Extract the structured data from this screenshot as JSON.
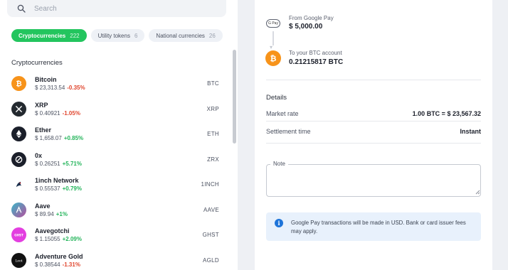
{
  "search": {
    "placeholder": "Search"
  },
  "tabs": [
    {
      "label": "Cryptocurrencies",
      "count": "222",
      "active": true
    },
    {
      "label": "Utility tokens",
      "count": "6",
      "active": false
    },
    {
      "label": "National currencies",
      "count": "26",
      "active": false
    }
  ],
  "list_title": "Cryptocurrencies",
  "coins": [
    {
      "name": "Bitcoin",
      "price": "$ 23,313.54",
      "change": "-0.35%",
      "ticker": "BTC",
      "icon": "bitcoin-icon",
      "color": "#f7931a"
    },
    {
      "name": "XRP",
      "price": "$ 0.40921",
      "change": "-1.05%",
      "ticker": "XRP",
      "icon": "xrp-icon",
      "color": "#23292f"
    },
    {
      "name": "Ether",
      "price": "$ 1,658.07",
      "change": "+0.85%",
      "ticker": "ETH",
      "icon": "ether-icon",
      "color": "#1b1f2a"
    },
    {
      "name": "0x",
      "price": "$ 0.26251",
      "change": "+5.71%",
      "ticker": "ZRX",
      "icon": "zerox-icon",
      "color": "#1b1f2a"
    },
    {
      "name": "1inch Network",
      "price": "$ 0.55537",
      "change": "+0.79%",
      "ticker": "1INCH",
      "icon": "oneinch-icon",
      "color": "#ffffff"
    },
    {
      "name": "Aave",
      "price": "$ 89.94",
      "change": "+1%",
      "ticker": "AAVE",
      "icon": "aave-icon",
      "color": "#6c7fd8"
    },
    {
      "name": "Aavegotchi",
      "price": "$ 1.15055",
      "change": "+2.09%",
      "ticker": "GHST",
      "icon": "aavegotchi-icon",
      "color": "#e33fe0"
    },
    {
      "name": "Adventure Gold",
      "price": "$ 0.38544",
      "change": "-1.31%",
      "ticker": "AGLD",
      "icon": "adventure-gold-icon",
      "color": "#111111"
    }
  ],
  "transfer": {
    "from_badge": "G Pay",
    "from_label": "From Google Pay",
    "from_value": "$ 5,000.00",
    "to_label": "To your BTC account",
    "to_value": "0.21215817 BTC"
  },
  "details": {
    "title": "Details",
    "rows": [
      {
        "label": "Market rate",
        "value": "1.00 BTC = $ 23,567.32"
      },
      {
        "label": "Settlement time",
        "value": "Instant"
      }
    ]
  },
  "note": {
    "label": "Note",
    "value": ""
  },
  "info": {
    "text": "Google Pay transactions will be made in USD. Bank or card issuer fees may apply."
  },
  "colors": {
    "accent_green": "#23c55e",
    "negative": "#e0452d",
    "positive": "#23b45a",
    "info_blue": "#1e74d9",
    "bitcoin_orange": "#f7931a"
  }
}
